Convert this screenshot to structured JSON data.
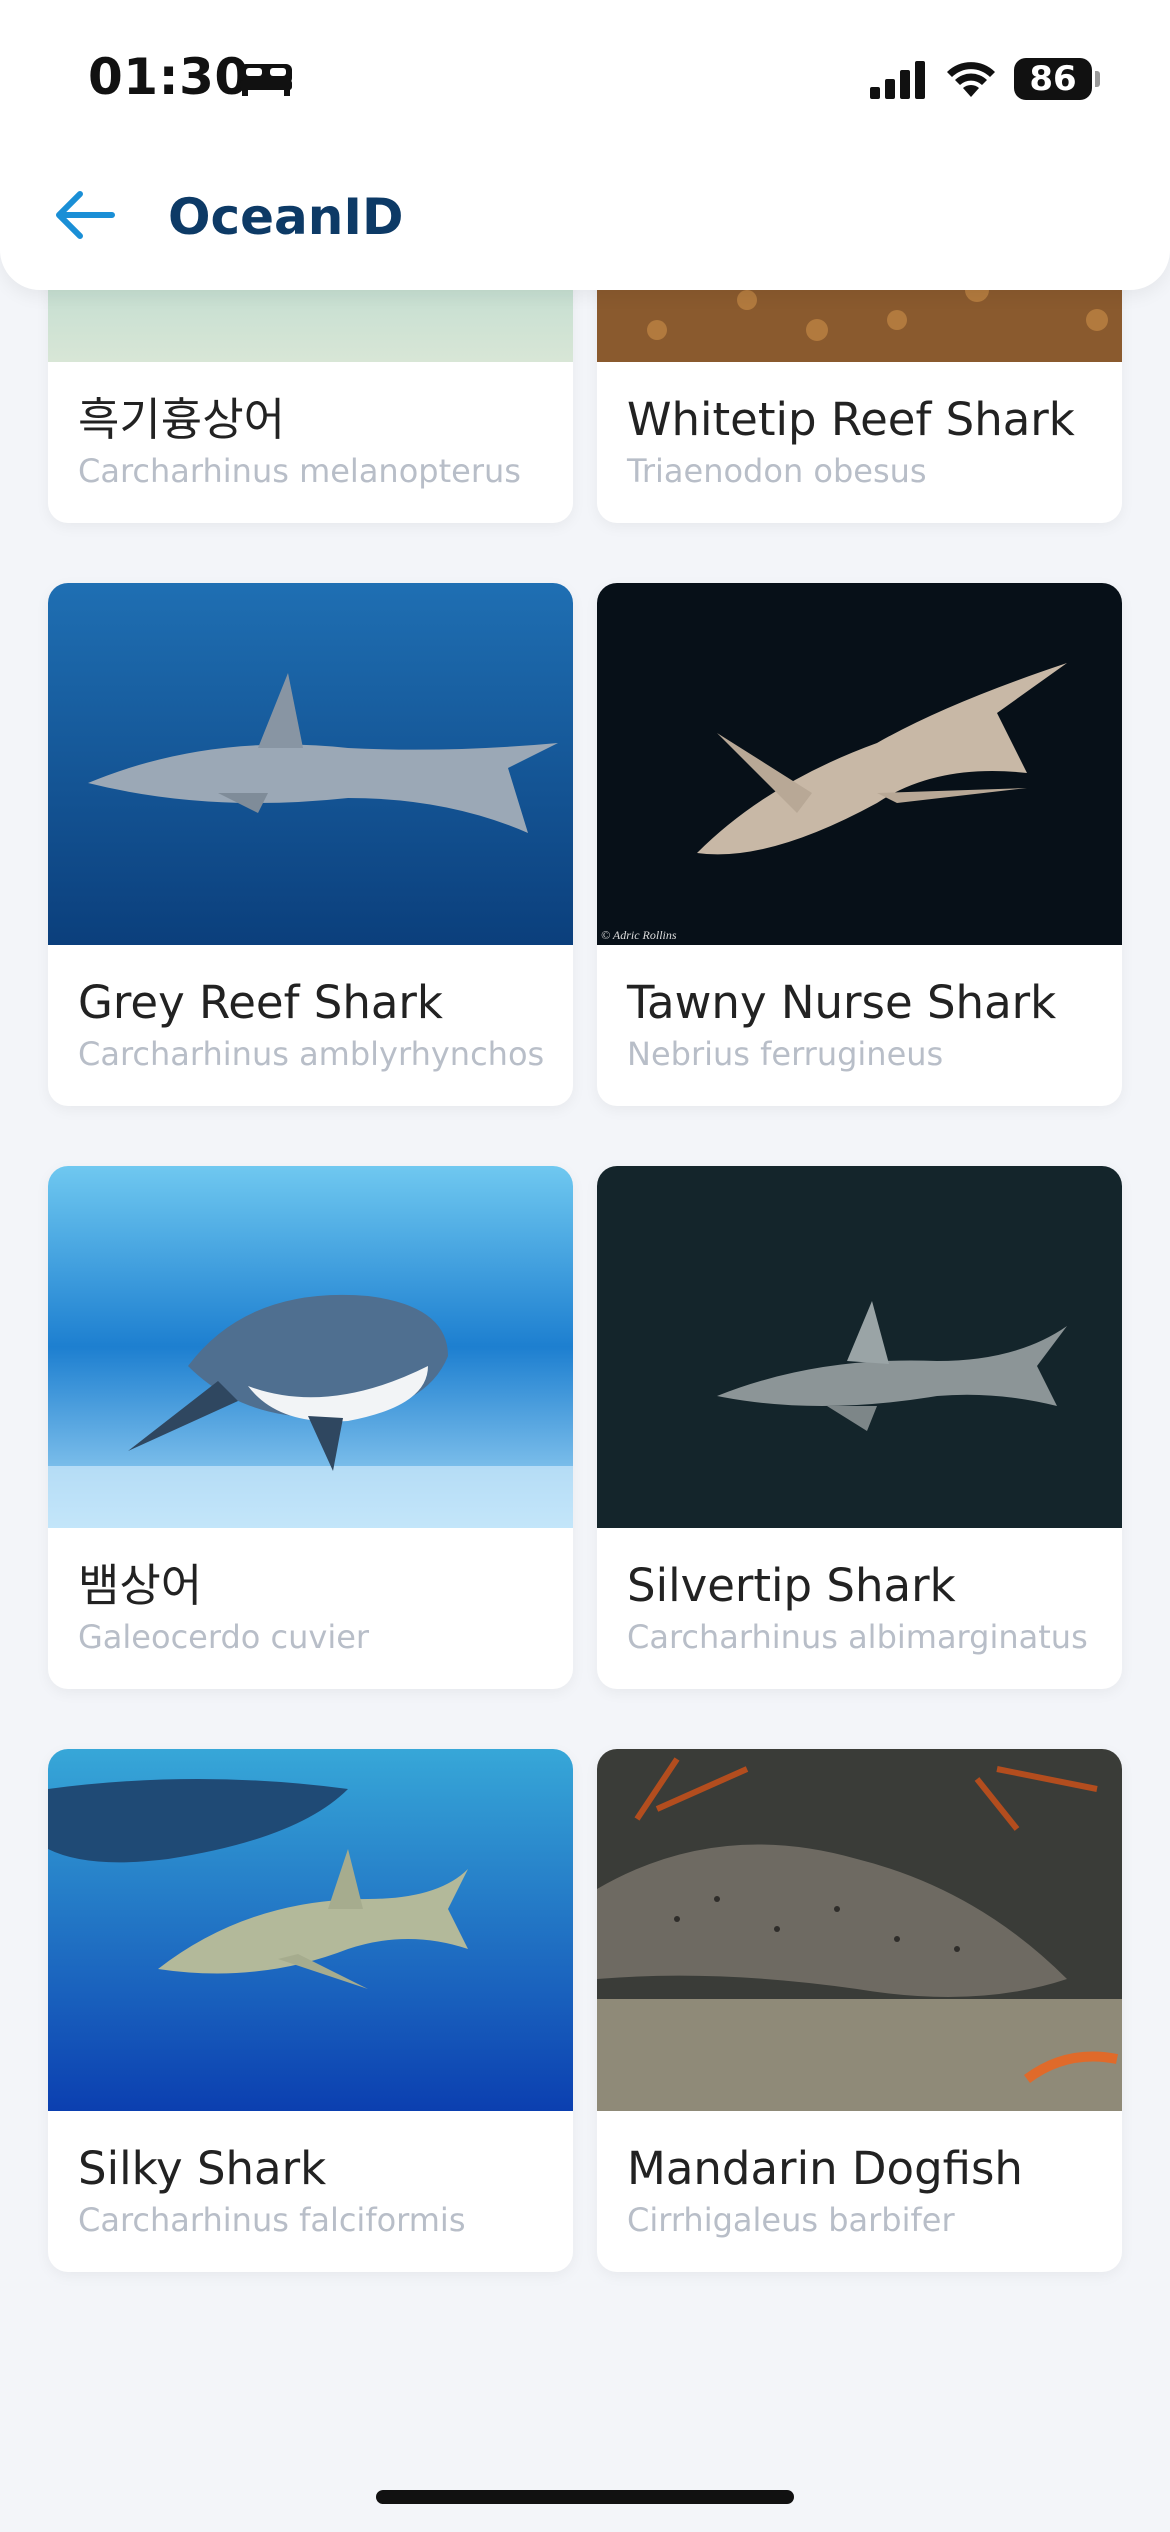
{
  "status_bar": {
    "time": "01:30",
    "battery": "86"
  },
  "header": {
    "title": "OceanID"
  },
  "cards": [
    {
      "name": "흑기흉상어",
      "scientific": "Carcharhinus melanopterus"
    },
    {
      "name": "Whitetip Reef Shark",
      "scientific": "Triaenodon obesus"
    },
    {
      "name": "Grey Reef Shark",
      "scientific": "Carcharhinus amblyrhynchos"
    },
    {
      "name": "Tawny Nurse Shark",
      "scientific": "Nebrius ferrugineus"
    },
    {
      "name": "뱀상어",
      "scientific": "Galeocerdo cuvier"
    },
    {
      "name": "Silvertip Shark",
      "scientific": "Carcharhinus albimarginatus"
    },
    {
      "name": "Silky Shark",
      "scientific": "Carcharhinus falciformis"
    },
    {
      "name": "Mandarin Dogfish",
      "scientific": "Cirrhigaleus barbifer"
    }
  ],
  "photo_credit": "© Adric Rollins"
}
